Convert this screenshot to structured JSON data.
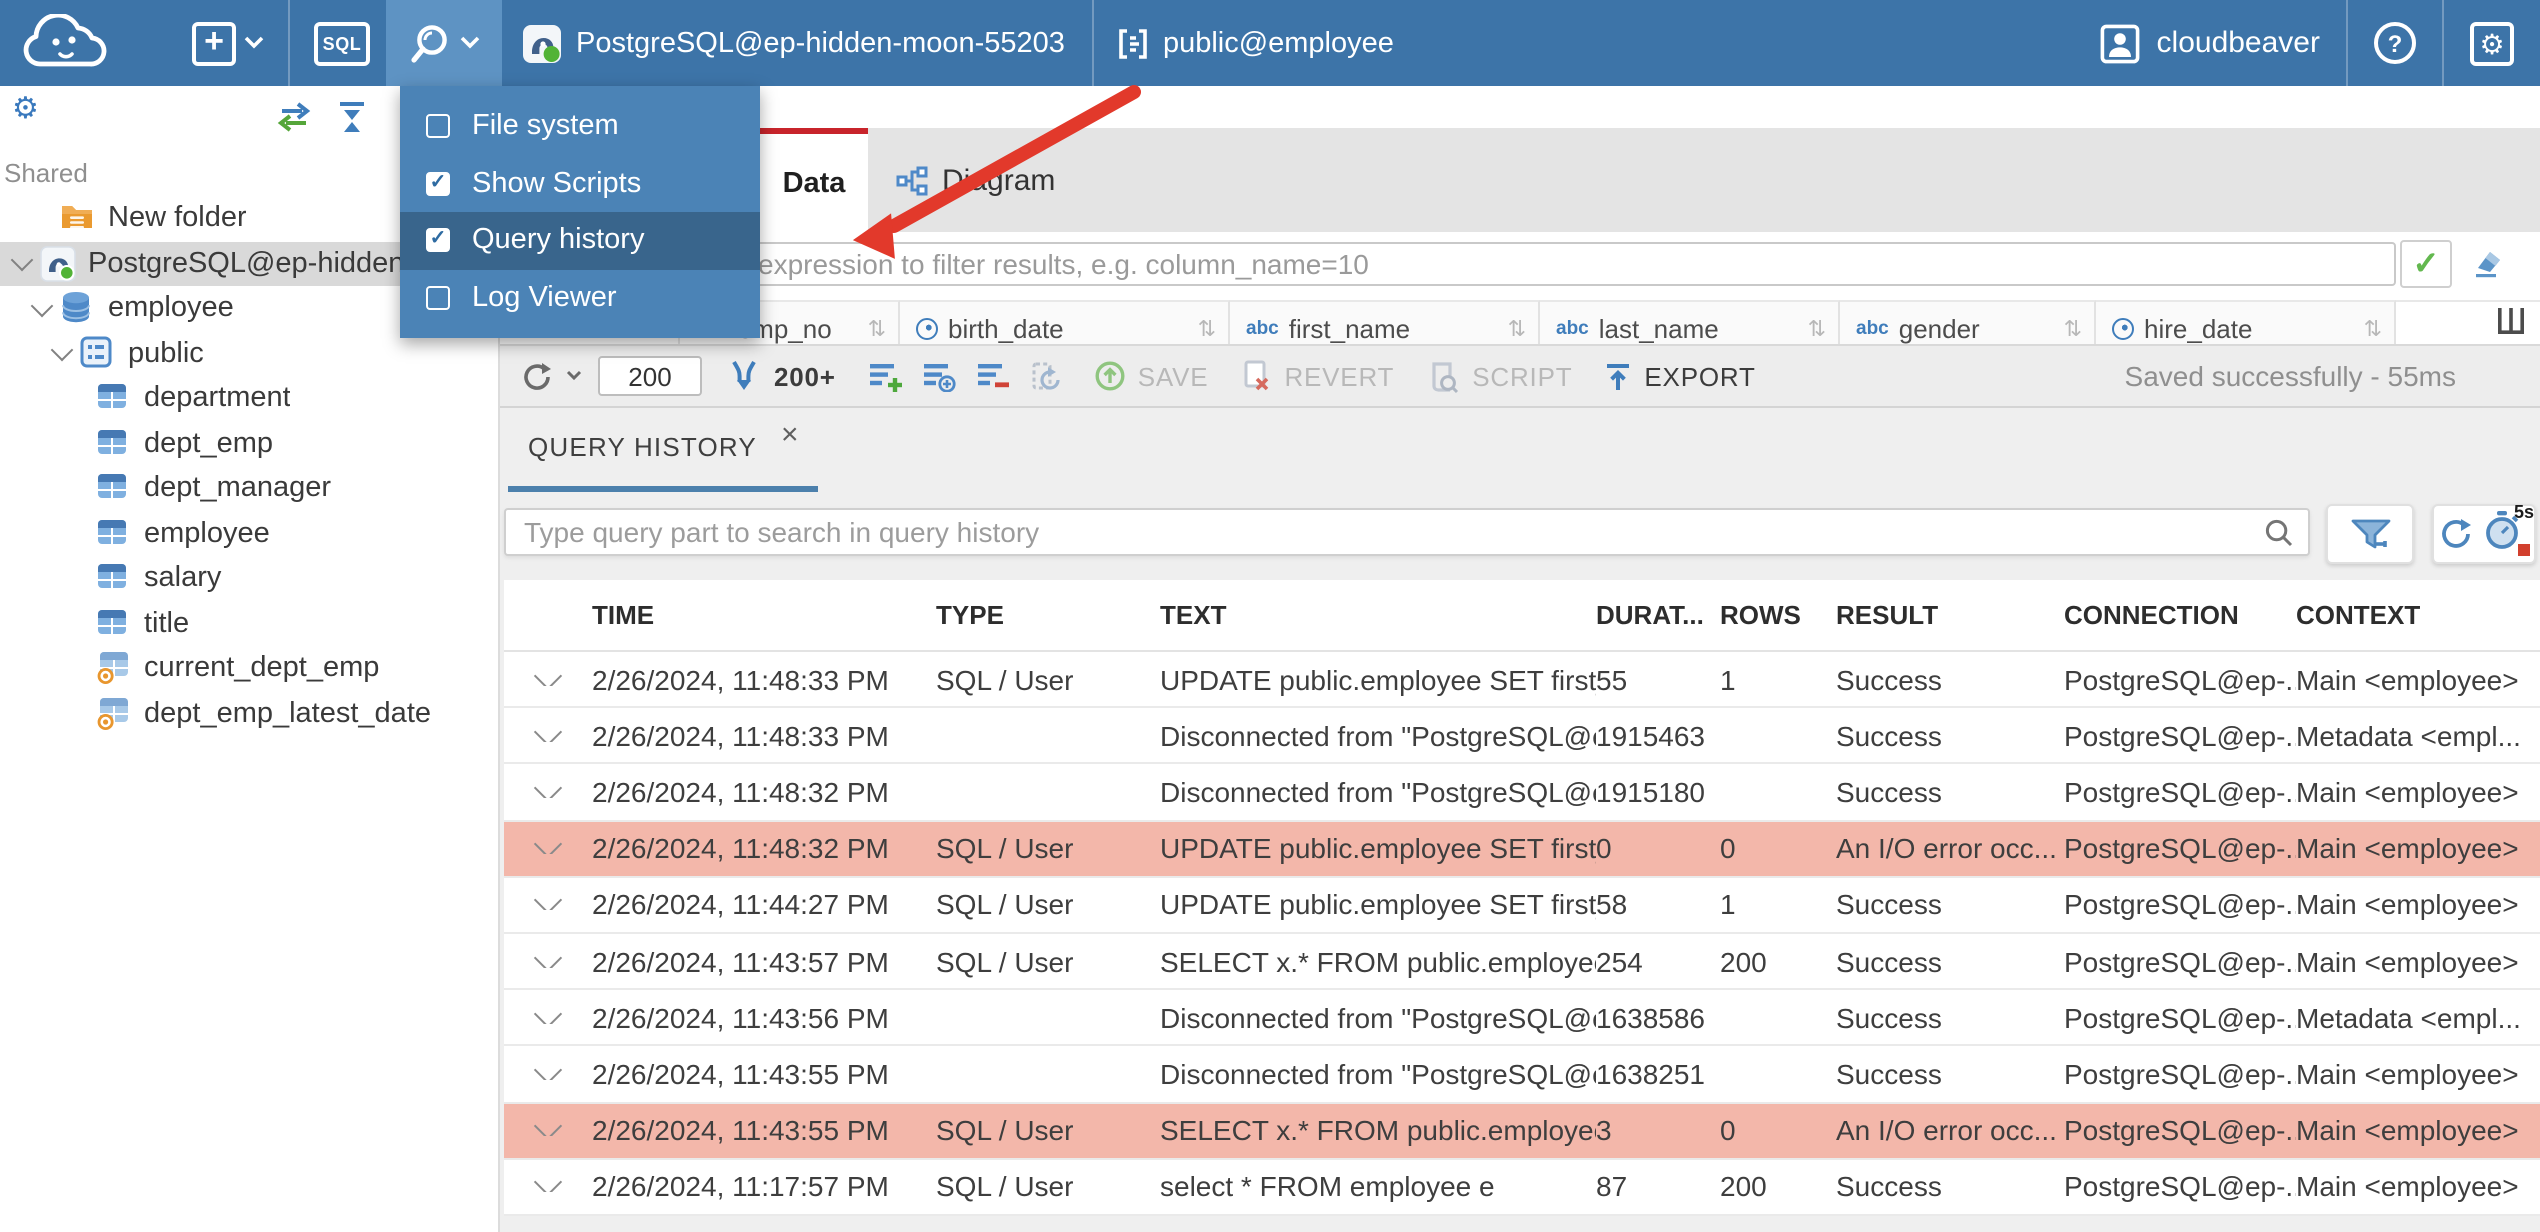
{
  "topbar": {
    "sql_label": "SQL",
    "connection": "PostgreSQL@ep-hidden-moon-55203",
    "object": "public@employee",
    "user": "cloudbeaver",
    "help": "?"
  },
  "tools_menu": {
    "items": [
      {
        "label": "File system",
        "checked": false,
        "highlighted": false
      },
      {
        "label": "Show Scripts",
        "checked": true,
        "highlighted": false
      },
      {
        "label": "Query history",
        "checked": true,
        "highlighted": true
      },
      {
        "label": "Log Viewer",
        "checked": false,
        "highlighted": false
      }
    ]
  },
  "sidebar": {
    "section": "Shared",
    "tree": [
      {
        "label": "New folder",
        "icon": "folder",
        "level": 1,
        "chevron": false,
        "selected": false
      },
      {
        "label": "PostgreSQL@ep-hidden-",
        "icon": "postgres",
        "level": 0,
        "chevron": true,
        "selected": true
      },
      {
        "label": "employee",
        "icon": "database",
        "level": 1,
        "chevron": true,
        "selected": false
      },
      {
        "label": "public",
        "icon": "schema",
        "level": 2,
        "chevron": true,
        "selected": false
      },
      {
        "label": "department",
        "icon": "table",
        "level": 3,
        "chevron": false,
        "selected": false
      },
      {
        "label": "dept_emp",
        "icon": "table",
        "level": 3,
        "chevron": false,
        "selected": false
      },
      {
        "label": "dept_manager",
        "icon": "table",
        "level": 3,
        "chevron": false,
        "selected": false
      },
      {
        "label": "employee",
        "icon": "table",
        "level": 3,
        "chevron": false,
        "selected": false
      },
      {
        "label": "salary",
        "icon": "table",
        "level": 3,
        "chevron": false,
        "selected": false
      },
      {
        "label": "title",
        "icon": "table",
        "level": 3,
        "chevron": false,
        "selected": false
      },
      {
        "label": "current_dept_emp",
        "icon": "view",
        "level": 3,
        "chevron": false,
        "selected": false
      },
      {
        "label": "dept_emp_latest_date",
        "icon": "view",
        "level": 3,
        "chevron": false,
        "selected": false
      }
    ]
  },
  "editor": {
    "tabs": [
      {
        "label": "Data",
        "active": true
      },
      {
        "label": "Diagram",
        "active": false
      }
    ],
    "filter_placeholder": "expression to filter results, e.g. column_name=10",
    "grid_columns": [
      {
        "name": "emp_no",
        "type": "123"
      },
      {
        "name": "birth_date",
        "type": "clock"
      },
      {
        "name": "first_name",
        "type": "abc"
      },
      {
        "name": "last_name",
        "type": "abc"
      },
      {
        "name": "gender",
        "type": "abc"
      },
      {
        "name": "hire_date",
        "type": "clock"
      }
    ],
    "toolbar": {
      "row_limit": "200",
      "fetch_label": "200+",
      "save": "SAVE",
      "revert": "REVERT",
      "script": "SCRIPT",
      "export": "EXPORT",
      "status": "Saved successfully - 55ms"
    }
  },
  "query_history": {
    "tab": "QUERY HISTORY",
    "close_label": "×",
    "search_placeholder": "Type query part to search in query history",
    "refresh_interval": "5s",
    "columns": [
      "TIME",
      "TYPE",
      "TEXT",
      "DURAT...",
      "ROWS",
      "RESULT",
      "CONNECTION",
      "CONTEXT"
    ],
    "rows": [
      {
        "time": "2/26/2024, 11:48:33 PM",
        "type": "SQL / User",
        "text": "UPDATE public.employee SET first_...",
        "duration": "55",
        "rows": "1",
        "result": "Success",
        "connection": "PostgreSQL@ep-...",
        "context": "Main <employee>",
        "error": false
      },
      {
        "time": "2/26/2024, 11:48:33 PM",
        "type": "",
        "text": "Disconnected from \"PostgreSQL@e...",
        "duration": "1915463",
        "rows": "",
        "result": "Success",
        "connection": "PostgreSQL@ep-...",
        "context": "Metadata <empl...",
        "error": false
      },
      {
        "time": "2/26/2024, 11:48:32 PM",
        "type": "",
        "text": "Disconnected from \"PostgreSQL@e...",
        "duration": "1915180",
        "rows": "",
        "result": "Success",
        "connection": "PostgreSQL@ep-...",
        "context": "Main <employee>",
        "error": false
      },
      {
        "time": "2/26/2024, 11:48:32 PM",
        "type": "SQL / User",
        "text": "UPDATE public.employee SET first_...",
        "duration": "0",
        "rows": "0",
        "result": "An I/O error occ...",
        "connection": "PostgreSQL@ep-...",
        "context": "Main <employee>",
        "error": true
      },
      {
        "time": "2/26/2024, 11:44:27 PM",
        "type": "SQL / User",
        "text": "UPDATE public.employee SET first_...",
        "duration": "58",
        "rows": "1",
        "result": "Success",
        "connection": "PostgreSQL@ep-...",
        "context": "Main <employee>",
        "error": false
      },
      {
        "time": "2/26/2024, 11:43:57 PM",
        "type": "SQL / User",
        "text": "SELECT x.* FROM public.employee x",
        "duration": "254",
        "rows": "200",
        "result": "Success",
        "connection": "PostgreSQL@ep-...",
        "context": "Main <employee>",
        "error": false
      },
      {
        "time": "2/26/2024, 11:43:56 PM",
        "type": "",
        "text": "Disconnected from \"PostgreSQL@e...",
        "duration": "1638586",
        "rows": "",
        "result": "Success",
        "connection": "PostgreSQL@ep-...",
        "context": "Metadata <empl...",
        "error": false
      },
      {
        "time": "2/26/2024, 11:43:55 PM",
        "type": "",
        "text": "Disconnected from \"PostgreSQL@e...",
        "duration": "1638251",
        "rows": "",
        "result": "Success",
        "connection": "PostgreSQL@ep-...",
        "context": "Main <employee>",
        "error": false
      },
      {
        "time": "2/26/2024, 11:43:55 PM",
        "type": "SQL / User",
        "text": "SELECT x.* FROM public.employee x",
        "duration": "3",
        "rows": "0",
        "result": "An I/O error occ...",
        "connection": "PostgreSQL@ep-...",
        "context": "Main <employee>",
        "error": true
      },
      {
        "time": "2/26/2024, 11:17:57 PM",
        "type": "SQL / User",
        "text": "select * FROM employee e",
        "duration": "87",
        "rows": "200",
        "result": "Success",
        "connection": "PostgreSQL@ep-...",
        "context": "Main <employee>",
        "error": false
      }
    ]
  },
  "colors": {
    "topbar": "#3d74a8",
    "topbar_active": "#5e93c3",
    "menu": "#4b83b6",
    "menu_highlight": "#39658c",
    "accent": "#3f7dbb",
    "tab_red": "#c8242b",
    "error_row": "#f3b7aa",
    "success_green": "#63b84f",
    "status_dot": "#52b336",
    "arrow_red": "#e2392b",
    "qh_underline": "#4c80ac"
  }
}
